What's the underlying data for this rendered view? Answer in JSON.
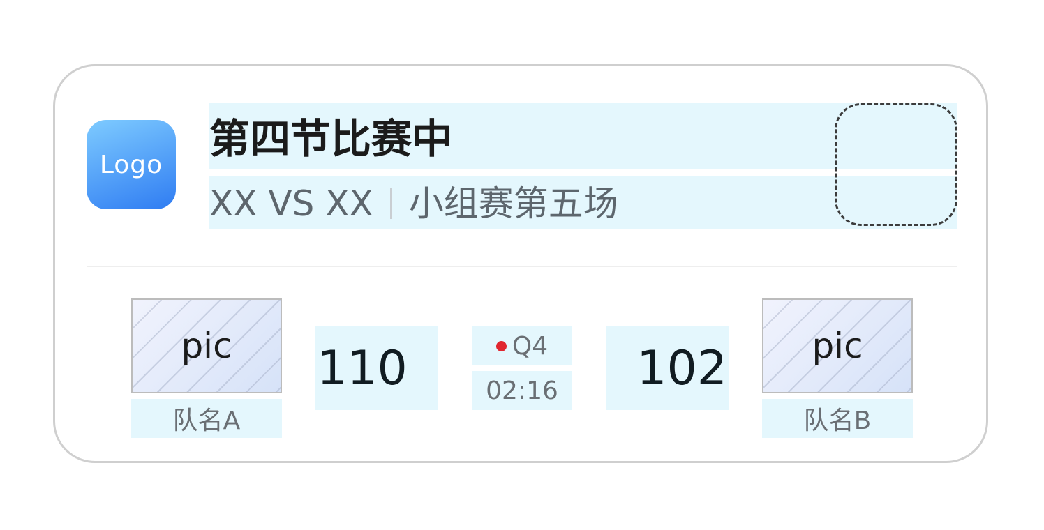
{
  "header": {
    "logo_text": "Logo",
    "title": "第四节比赛中",
    "matchup": "XX VS XX",
    "match_info": "小组赛第五场"
  },
  "scoreboard": {
    "team_a": {
      "pic_label": "pic",
      "name": "队名A",
      "score": "110"
    },
    "team_b": {
      "pic_label": "pic",
      "name": "队名B",
      "score": "102"
    },
    "quarter": "Q4",
    "clock": "02:16",
    "live_indicator_color": "#e0262f"
  },
  "colors": {
    "logo_gradient_start": "#7ecbff",
    "logo_gradient_end": "#2f7cf2",
    "highlight_bg": "#e4f7fd",
    "card_border": "#cfcfcf"
  },
  "icons": {
    "dashed_placeholder": "dashed-placeholder-icon"
  }
}
